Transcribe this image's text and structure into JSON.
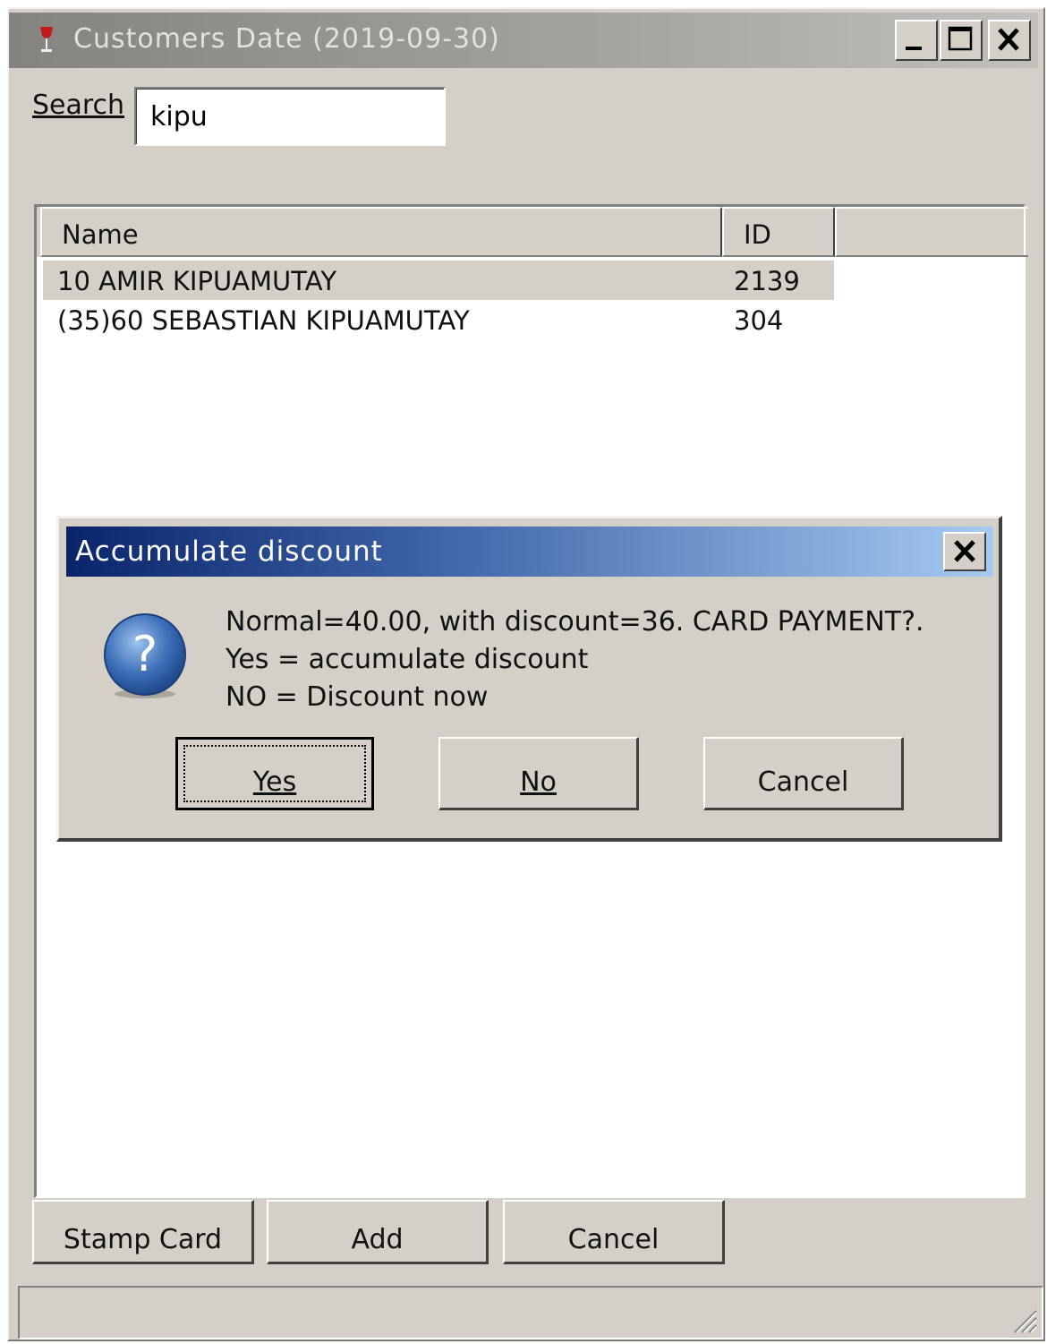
{
  "window": {
    "title": "Customers Date (2019-09-30)"
  },
  "search": {
    "label": "Search",
    "value": "kipu"
  },
  "list": {
    "columns": [
      "Name",
      "ID"
    ],
    "rows": [
      {
        "name": "10  AMIR KIPUAMUTAY",
        "id": "2139",
        "selected": true
      },
      {
        "name": "(35)60 SEBASTIAN KIPUAMUTAY",
        "id": "304",
        "selected": false
      }
    ]
  },
  "buttons": {
    "stamp_card": "Stamp Card",
    "add": "Add",
    "cancel": "Cancel"
  },
  "dialog": {
    "title": "Accumulate discount",
    "message_lines": [
      "Normal=40.00, with discount=36. CARD PAYMENT?.",
      " Yes = accumulate discount",
      " NO = Discount now"
    ],
    "yes": "Yes",
    "no": "No",
    "cancel": "Cancel"
  },
  "colors": {
    "face": "#d4d0c8",
    "dialog_title_start": "#0a246a",
    "dialog_title_end": "#a6caf0",
    "inactive_title": "#a3a19d"
  },
  "icons": [
    "wine-glass-icon",
    "minimize-icon",
    "maximize-icon",
    "close-icon",
    "question-icon",
    "resize-grip-icon"
  ]
}
